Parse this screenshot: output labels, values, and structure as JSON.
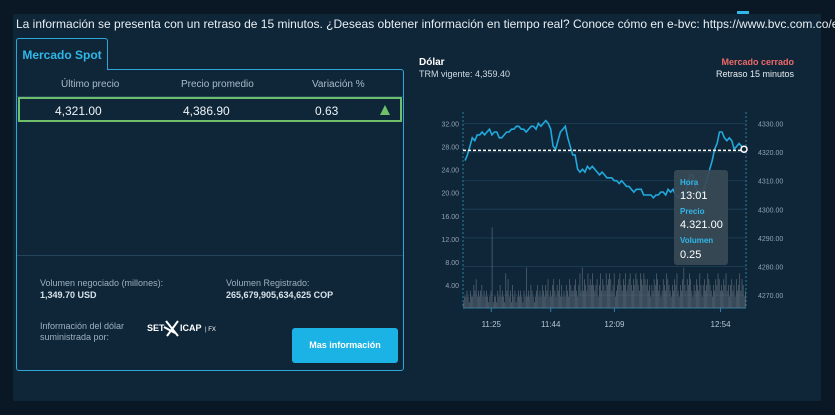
{
  "notice": "La información se presenta con un retraso de 15 minutos. ¿Deseas obtener información en tiempo real? Conoce cómo en e-bvc: https://www.bvc.com.co/e-bvc",
  "tab_label": "Mercado Spot",
  "table": {
    "headers": [
      "Último precio",
      "Precio promedio",
      "Variación %"
    ],
    "row": [
      "4,321.00",
      "4,386.90",
      "0.63"
    ]
  },
  "volumen_negociado": {
    "label": "Volumen negociado (millones):",
    "value": "1,349.70 USD"
  },
  "volumen_registrado": {
    "label": "Volumen Registrado:",
    "value": "265,679,905,634,625 COP"
  },
  "suministro_label": "Información del dólar suministrada por:",
  "logo": {
    "left": "SET",
    "right": "ICAP",
    "suffix": "| FX"
  },
  "button_label": "Mas información",
  "chart_header": {
    "title": "Dólar",
    "trm": "TRM vigente: 4,359.40",
    "status": "Mercado cerrado",
    "delay": "Retraso 15 minutos"
  },
  "tooltip": {
    "hora_label": "Hora",
    "hora": "13:01",
    "precio_label": "Precio",
    "precio": "4.321.00",
    "volumen_label": "Volumen",
    "volumen": "0.25"
  },
  "colors": {
    "accent": "#2fb7e8",
    "up": "#6ec26a",
    "closed": "#f06969",
    "line": "#22a9dc",
    "volume": "#6b7782"
  },
  "chart_data": {
    "type": "line",
    "x_ticks": [
      "11:25",
      "11:44",
      "12:09",
      "12:54"
    ],
    "price_axis": {
      "ticks": [
        "4330.00",
        "4320.00",
        "4310.00",
        "4300.00",
        "4290.00",
        "4280.00",
        "4270.00"
      ],
      "ylim": [
        4265.5,
        4334
      ]
    },
    "volume_axis": {
      "ticks": [
        "32.00",
        "28.00",
        "24.00",
        "20.00",
        "16.00",
        "12.00",
        "8.00",
        "4.00"
      ],
      "ylim": [
        0,
        34
      ]
    },
    "reference_price": 4320.6,
    "price": [
      4317,
      4319,
      4322,
      4325,
      4324,
      4326,
      4326,
      4327,
      4326,
      4327,
      4328,
      4326,
      4327,
      4327,
      4325,
      4325,
      4326,
      4327,
      4327,
      4328,
      4328,
      4329,
      4329,
      4328,
      4328,
      4327,
      4328,
      4329,
      4329,
      4328,
      4330,
      4329,
      4330,
      4331,
      4330,
      4328,
      4322,
      4321,
      4324,
      4327,
      4328,
      4329,
      4325,
      4322,
      4319,
      4319,
      4314,
      4313,
      4314,
      4313,
      4315,
      4314,
      4315,
      4314,
      4313,
      4312,
      4313,
      4312,
      4311,
      4311,
      4311,
      4310,
      4310,
      4309,
      4310,
      4309,
      4308,
      4308,
      4307,
      4306,
      4307,
      4307,
      4307,
      4305,
      4305,
      4305,
      4305,
      4304,
      4305,
      4305,
      4306,
      4306,
      4305,
      4307,
      4306,
      4307,
      4305,
      4304,
      4305,
      4304,
      4305,
      4309,
      4312,
      4312,
      4308,
      4306,
      4305,
      4306,
      4308,
      4311,
      4314,
      4317,
      4321,
      4323,
      4327,
      4327,
      4325,
      4324,
      4325,
      4324,
      4321,
      4322,
      4323,
      4322,
      4321
    ],
    "volume": [
      1,
      2,
      2,
      3,
      2,
      1,
      3,
      2,
      2,
      4,
      3,
      5,
      2,
      3,
      2,
      3,
      4,
      2,
      3,
      2,
      3,
      2,
      1,
      2,
      3,
      14,
      1,
      2,
      2,
      1,
      3,
      2,
      4,
      2,
      3,
      2,
      1,
      6,
      3,
      5,
      2,
      3,
      1,
      4,
      2,
      3,
      1,
      2,
      3,
      2,
      3,
      2,
      1,
      3,
      2,
      7,
      2,
      3,
      2,
      4,
      3,
      2,
      1,
      2,
      3,
      4,
      2,
      3,
      2,
      4,
      3,
      2,
      4,
      3,
      5,
      2,
      3,
      2,
      4,
      5,
      3,
      2,
      4,
      3,
      5,
      2,
      4,
      2,
      3,
      2,
      4,
      3,
      2,
      5,
      4,
      3,
      3,
      4,
      5,
      3,
      2,
      4,
      6,
      3,
      7,
      3,
      5,
      4,
      3,
      6,
      4,
      5,
      4,
      6,
      4,
      3,
      4,
      5,
      2,
      4,
      6,
      3,
      5,
      4,
      3,
      6,
      4,
      5,
      6,
      5,
      3,
      4,
      6,
      2,
      3,
      4,
      5,
      6,
      4,
      3,
      5,
      4,
      6,
      3,
      4,
      5,
      6,
      4,
      3,
      5,
      4,
      6,
      5,
      4,
      3,
      6,
      5,
      4,
      6,
      5,
      4,
      5,
      3,
      4,
      2,
      4,
      3,
      5,
      4,
      6,
      5,
      3,
      4,
      2,
      3,
      5,
      4,
      3,
      6,
      5,
      4,
      3,
      2,
      4,
      3,
      5,
      4,
      6,
      3,
      2,
      4,
      3,
      5,
      7,
      4,
      3,
      5,
      4,
      6,
      5,
      3,
      2,
      4,
      3,
      5,
      4,
      3,
      6,
      4,
      2,
      4,
      5,
      3,
      4,
      6,
      5,
      4,
      3,
      2,
      4,
      3,
      5,
      4,
      6,
      5,
      3,
      4,
      3,
      5,
      4,
      6,
      3,
      4,
      2,
      4,
      5,
      3,
      4,
      2,
      5,
      3,
      4,
      6,
      3,
      5,
      4,
      2,
      3
    ]
  }
}
